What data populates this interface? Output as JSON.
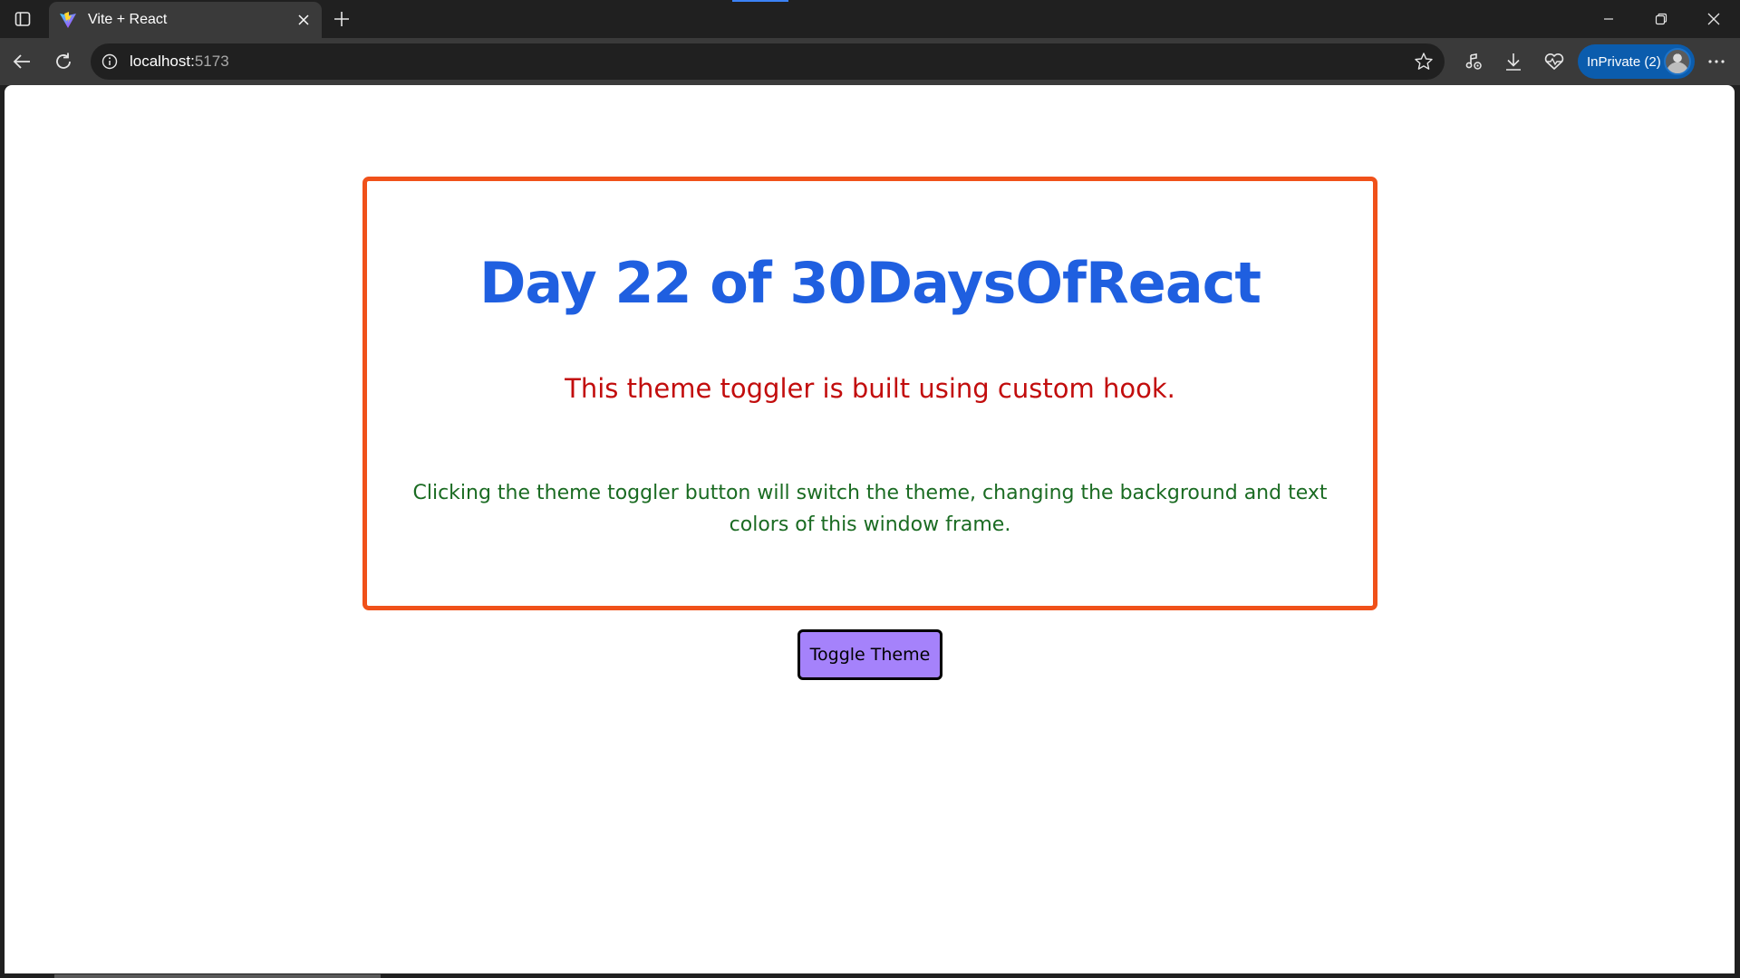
{
  "browser": {
    "tab": {
      "title": "Vite + React",
      "favicon": "vite-logo-icon"
    },
    "address": {
      "host": "localhost:",
      "port": "5173"
    },
    "profile_badge": "InPrivate (2)",
    "icons": [
      "sidebar-toggle-icon",
      "close-icon",
      "plus-icon",
      "minimize-icon",
      "restore-icon",
      "back-arrow-icon",
      "reload-icon",
      "info-icon",
      "star-icon",
      "music-note-icon",
      "download-icon",
      "heartbeat-icon",
      "more-icon"
    ],
    "accent_color": "#0b5cad"
  },
  "app": {
    "title": "Day 22 of 30DaysOfReact",
    "subtitle": "This theme toggler is built using custom hook.",
    "description": "Clicking the theme toggler button will switch the theme, changing the background and text colors of this window frame.",
    "button_label": "Toggle Theme",
    "colors": {
      "frame_border": "#f0511a",
      "title": "#1f5fe0",
      "subtitle": "#c20d0d",
      "description": "#1a6b22",
      "button_bg": "#a582fb"
    }
  }
}
